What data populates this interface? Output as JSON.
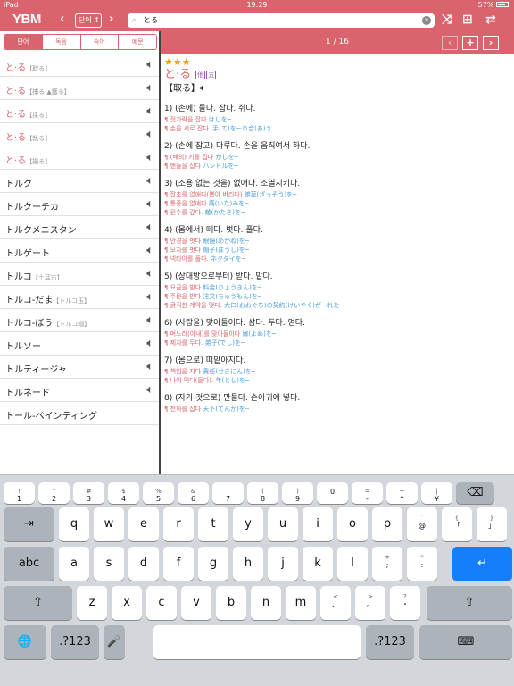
{
  "status": {
    "device": "iPad",
    "time": "19:29",
    "battery": "57%"
  },
  "topbar": {
    "logo": "YBM",
    "dict_select": "단어 ↕",
    "search_text": "とる"
  },
  "tabs": [
    "단어",
    "독음",
    "숙어",
    "예문"
  ],
  "left_list": [
    {
      "word": "と·る",
      "kanji": "【取る】",
      "jp": true
    },
    {
      "word": "と·る",
      "kanji": "【捕る·▲獲る】",
      "jp": true
    },
    {
      "word": "と·る",
      "kanji": "【採る】",
      "jp": true
    },
    {
      "word": "と·る",
      "kanji": "【執る】",
      "jp": true
    },
    {
      "word": "と·る",
      "kanji": "【撮る】",
      "jp": true
    },
    {
      "word": "トルク",
      "kanji": "",
      "jp": false
    },
    {
      "word": "トルクーチカ",
      "kanji": "",
      "jp": false
    },
    {
      "word": "トルクメニスタン",
      "kanji": "",
      "jp": false
    },
    {
      "word": "トルゲート",
      "kanji": "",
      "jp": false
    },
    {
      "word": "トルコ",
      "kanji": "【土耳古】",
      "jp": false
    },
    {
      "word": "トルコ-だま",
      "kanji": "【トルコ玉】",
      "jp": false
    },
    {
      "word": "トルコ-ぼう",
      "kanji": "【トルコ帽】",
      "jp": false
    },
    {
      "word": "トルソー",
      "kanji": "",
      "jp": false
    },
    {
      "word": "トルティージャ",
      "kanji": "",
      "jp": false
    },
    {
      "word": "トルネード",
      "kanji": "",
      "jp": false
    },
    {
      "word": "トール-ペインティング",
      "kanji": "",
      "jp": false
    }
  ],
  "right_header": {
    "page": "1 / 16"
  },
  "entry": {
    "stars": "★★★",
    "headword": "と·る",
    "badges": [
      "他",
      "五"
    ],
    "kanji": "【取る】",
    "senses": [
      {
        "title": "1) (손에) 들다. 잡다. 쥐다.",
        "examples": [
          {
            "kr": "¶ 젓가락을 잡다",
            "jp": "はしを─"
          },
          {
            "kr": "¶ 손을 서로 잡다.",
            "jp": "手(て)を─·り合(あ)う"
          }
        ]
      },
      {
        "title": "2) (손에 잡고) 다루다. 손을 움직여서 하다.",
        "examples": [
          {
            "kr": "¶ (배의) 키를 잡다",
            "jp": "かじを─"
          },
          {
            "kr": "¶ 핸들을 잡다",
            "jp": "ハンドルを─"
          }
        ]
      },
      {
        "title": "3) (소용 없는 것을) 없애다. 소멸시키다.",
        "examples": [
          {
            "kr": "¶ 잡초를 없애다(뽑아 버리다)",
            "jp": "雑草(ざっそう)を─"
          },
          {
            "kr": "¶ 통증을 없애다",
            "jp": "痛(いた)みを─"
          },
          {
            "kr": "¶ 원수를 갚다.",
            "jp": "敵(かたき)を─"
          }
        ]
      },
      {
        "title": "4) (몸에서) 떼다. 벗다. 풀다.",
        "examples": [
          {
            "kr": "¶ 안경을 벗다",
            "jp": "眼鏡(めがね)を─"
          },
          {
            "kr": "¶ 모자를 벗다",
            "jp": "帽子(ぼうし)を─"
          },
          {
            "kr": "¶ 넥타이를 풀다.",
            "jp": "ネクタイを─"
          }
        ]
      },
      {
        "title": "5) (상대방으로부터) 받다. 맡다.",
        "examples": [
          {
            "kr": "¶ 요금을 받다",
            "jp": "料金(りょうきん)を─"
          },
          {
            "kr": "¶ 주문을 받다",
            "jp": "注文(ちゅうもん)を─"
          },
          {
            "kr": "¶ 굵직한 계약을 맺다.",
            "jp": "大口(おおぐち)の契約(けいやく)が─·れた"
          }
        ]
      },
      {
        "title": "6) (사람을) 맞아들이다. 삼다. 두다. 얻다.",
        "examples": [
          {
            "kr": "¶ 며느리(아내)를 맞아들이다",
            "jp": "嫁(よめ)を─"
          },
          {
            "kr": "¶ 제자를 두다.",
            "jp": "弟子(でし)を─"
          }
        ]
      },
      {
        "title": "7) (몸으로) 떠맡아지다.",
        "examples": [
          {
            "kr": "¶ 책임을 지다",
            "jp": "責任(せきにん)を─"
          },
          {
            "kr": "¶ 나이 먹다(들다).",
            "jp": "年(とし)を─"
          }
        ]
      },
      {
        "title": "8) (자기 것으로) 만들다. 손아귀에 넣다.",
        "examples": [
          {
            "kr": "¶ 천하를 잡다",
            "jp": "天下(てんか)を─"
          }
        ]
      }
    ]
  },
  "keyboard": {
    "row1": [
      [
        "!",
        "1"
      ],
      [
        "\"",
        "2"
      ],
      [
        "#",
        "3"
      ],
      [
        "$",
        "4"
      ],
      [
        "%",
        "5"
      ],
      [
        "&",
        "6"
      ],
      [
        "'",
        "7"
      ],
      [
        "(",
        "8"
      ],
      [
        ")",
        "9"
      ],
      [
        "",
        "0"
      ],
      [
        "=",
        "-"
      ],
      [
        "~",
        "^"
      ],
      [
        "|",
        "¥"
      ]
    ],
    "row2": [
      "q",
      "w",
      "e",
      "r",
      "t",
      "y",
      "u",
      "i",
      "o",
      "p",
      [
        "`",
        "@"
      ],
      [
        "{",
        "「"
      ],
      [
        "}",
        "」"
      ]
    ],
    "row3": [
      "a",
      "s",
      "d",
      "f",
      "g",
      "h",
      "j",
      "k",
      "l",
      [
        "+",
        ";"
      ],
      [
        "*",
        ":"
      ]
    ],
    "row4": [
      "z",
      "x",
      "c",
      "v",
      "b",
      "n",
      "m",
      [
        "<",
        "、"
      ],
      [
        ">",
        "。"
      ],
      [
        "?",
        "・"
      ]
    ],
    "tab_label": "⇥",
    "caps_label": "abc",
    "return_label": "↵",
    "shift_label": "⇧",
    "delete_label": "⌫",
    "globe_label": "🌐",
    "numbers_label": ".?123",
    "mic_label": "🎤",
    "kb_dismiss_label": "⌨"
  }
}
